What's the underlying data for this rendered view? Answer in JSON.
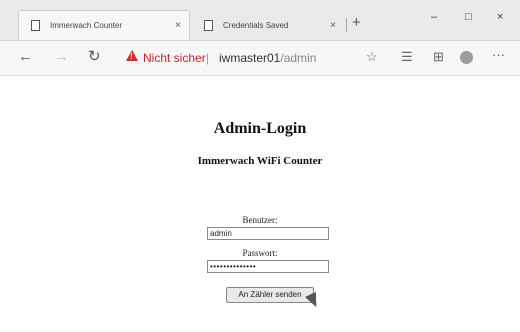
{
  "tabs": [
    {
      "title": "Immerwach Counter",
      "close": "×"
    },
    {
      "title": "Credentials Saved",
      "close": "×"
    }
  ],
  "tabstrip": {
    "new_tab": "+"
  },
  "window_controls": {
    "minimize": "–",
    "maximize": "□",
    "close": "×"
  },
  "toolbar": {
    "back": "←",
    "forward": "→",
    "refresh": "↻",
    "security_text": "Nicht sicher",
    "separator": "|",
    "url_host": "iwmaster01",
    "url_path": "/admin",
    "favorite": "☆",
    "favorites": "☰",
    "collections": "⊞",
    "more": "···"
  },
  "page": {
    "title": "Admin-Login",
    "subtitle": "Immerwach WiFi Counter",
    "username_label": "Benutzer:",
    "username_value": "admin",
    "password_label": "Passwort:",
    "password_value": "••••••••••••••",
    "submit_label": "An Zähler senden"
  },
  "icons": {
    "tab_page": "page-icon",
    "warning": "warning-triangle-icon",
    "profile": "profile-avatar-icon",
    "cursor": "mouse-pointer-icon"
  },
  "colors": {
    "insecure": "#c62828",
    "tabstrip": "#eaeaea",
    "toolbar": "#f7f7f7"
  }
}
